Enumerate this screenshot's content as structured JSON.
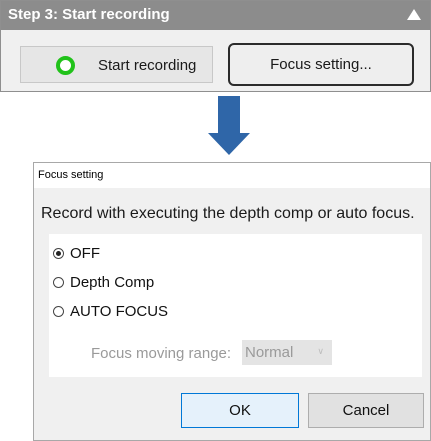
{
  "panel": {
    "title": "Step 3: Start recording",
    "start_button_label": "Start recording",
    "focus_button_label": "Focus setting..."
  },
  "dialog": {
    "title": "Focus setting",
    "description": "Record with executing the depth comp or auto focus.",
    "options": [
      {
        "label": "OFF",
        "selected": true
      },
      {
        "label": "Depth Comp",
        "selected": false
      },
      {
        "label": "AUTO FOCUS",
        "selected": false
      }
    ],
    "range_label": "Focus moving range:",
    "range_value": "Normal",
    "ok_label": "OK",
    "cancel_label": "Cancel"
  },
  "colors": {
    "header_bg": "#8c8c8c",
    "record_icon": "#21c21a",
    "arrow": "#2f66a8",
    "ok_border": "#0078d7"
  },
  "icons": [
    "collapse-up-icon",
    "record-circle-icon",
    "down-arrow-icon",
    "chevron-down-icon"
  ]
}
